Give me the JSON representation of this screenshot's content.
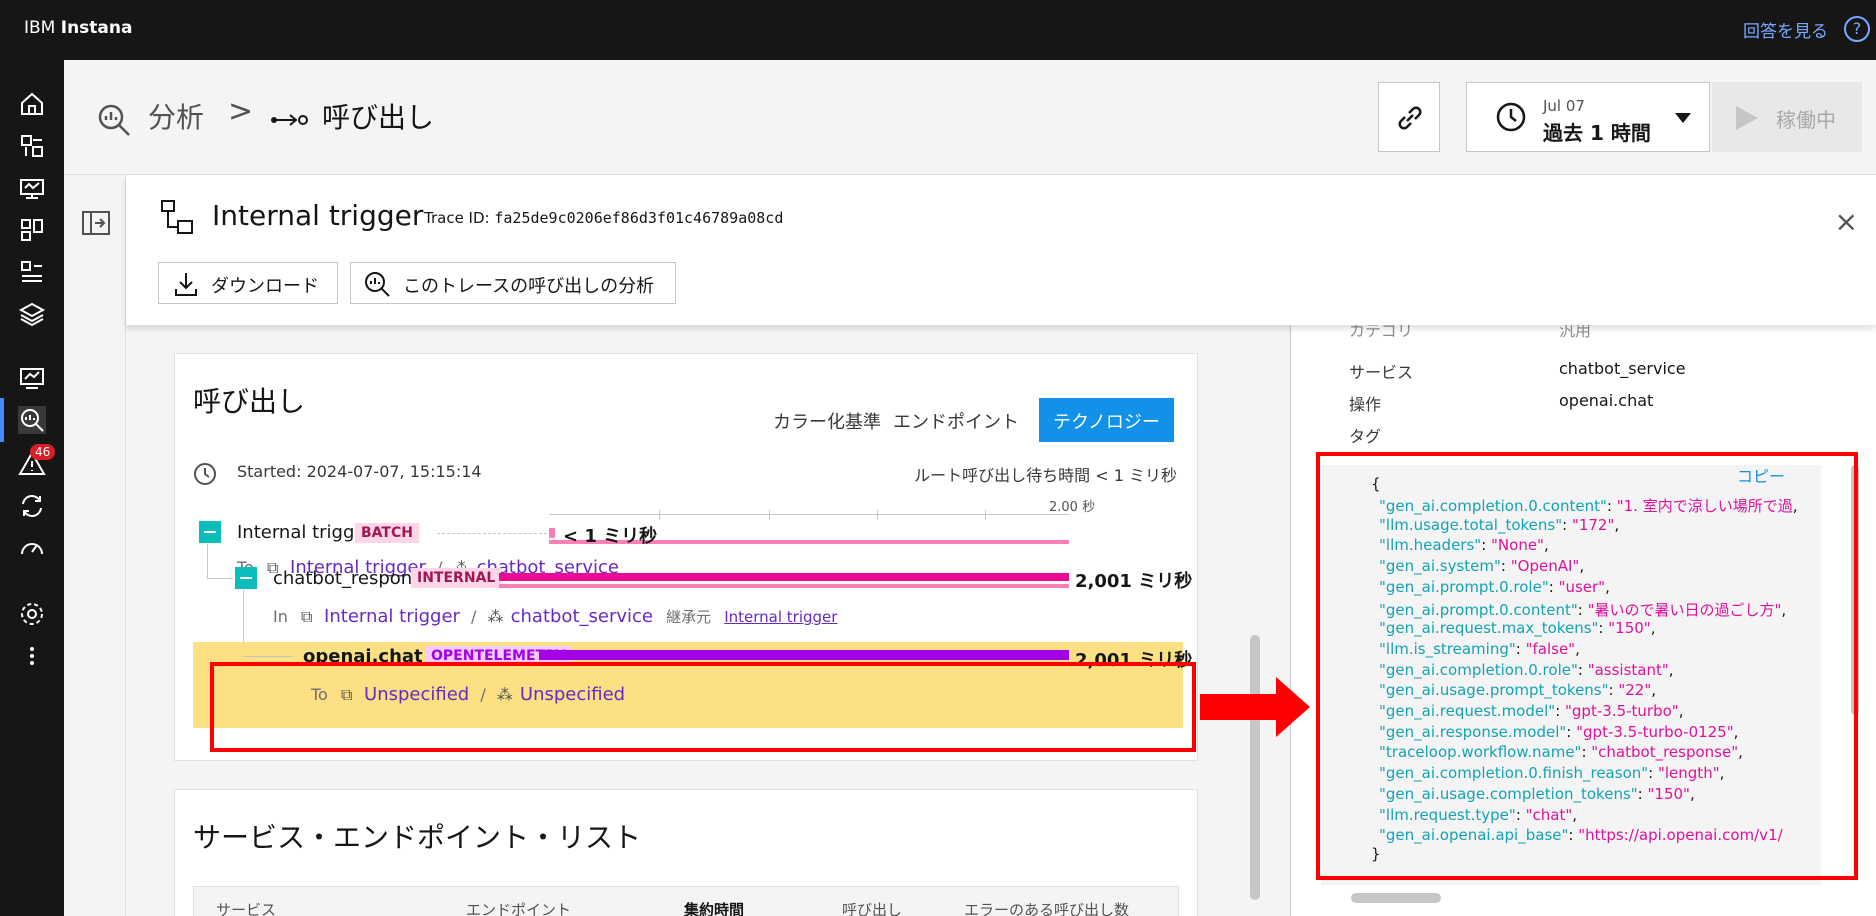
{
  "app": {
    "brand_prefix": "IBM ",
    "brand_name": "Instana",
    "help_text": "回答を見る",
    "help_icon": "?"
  },
  "nav": {
    "icons": [
      "home-icon",
      "dashboard-icon",
      "infrastructure-icon",
      "apps-icon",
      "services-icon",
      "layers-icon",
      "monitoring-icon",
      "analytics-icon",
      "alert-icon",
      "sync-icon",
      "gauge-icon",
      "settings-icon",
      "more-icon"
    ],
    "alert_badge": "46"
  },
  "header": {
    "crumb1": "分析",
    "crumb_sep": ">",
    "crumb2": "呼び出し",
    "time_date": "Jul 07",
    "time_range": "過去 1 時間",
    "run_label": "稼働中"
  },
  "trace": {
    "title": "Internal trigger",
    "trace_id_label": "Trace ID: ",
    "trace_id": "fa25de9c0206ef86d3f01c46789a08cd",
    "download_label": "ダウンロード",
    "analyze_label": "このトレースの呼び出しの分析",
    "close": "×"
  },
  "calls": {
    "title": "呼び出し",
    "color_by_label": "カラー化基準",
    "endpoint_label": "エンドポイント",
    "tech_label": "テクノロジー",
    "started": "Started: 2024-07-07, 15:15:14",
    "root_latency": "ルート呼び出し待ち時間 < 1 ミリ秒",
    "axis_tick": "2.00 秒",
    "rows": [
      {
        "name": "Internal trigger",
        "badge": "BATCH",
        "duration": "< 1 ミリ秒",
        "prefix": "To",
        "link1": "Internal trigger",
        "sep": "/",
        "link2": "chatbot_service"
      },
      {
        "name": "chatbot_response....",
        "badge": "INTERNAL",
        "duration": "2,001 ミリ秒",
        "prefix": "In",
        "link1": "Internal trigger",
        "sep": "/",
        "link2": "chatbot_service",
        "inherit_label": "継承元",
        "inherit_link": "Internal trigger"
      },
      {
        "name": "openai.chat",
        "badge": "OPENTELEMETRY",
        "duration": "2,001 ミリ秒",
        "prefix": "To",
        "link1": "Unspecified",
        "sep": "/",
        "link2": "Unspecified"
      }
    ]
  },
  "services_list": {
    "title": "サービス・エンドポイント・リスト",
    "columns": [
      "サービス",
      "エンドポイント",
      "集約時間",
      "呼び出し",
      "エラーのある呼び出し数"
    ]
  },
  "details": {
    "partial_label": "カテゴリ",
    "partial_value": "汎用",
    "service_label": "サービス",
    "service_value": "chatbot_service",
    "operation_label": "操作",
    "operation_value": "openai.chat",
    "tags_label": "タグ",
    "copy_label": "コピー",
    "json_open": "{",
    "json_close": "}",
    "json_lines": [
      {
        "k": "\"gen_ai.completion.0.content\"",
        "v": "\"1. 室内で涼しい場所で過"
      },
      {
        "k": "\"llm.usage.total_tokens\"",
        "v": "\"172\""
      },
      {
        "k": "\"llm.headers\"",
        "v": "\"None\""
      },
      {
        "k": "\"gen_ai.system\"",
        "v": "\"OpenAI\""
      },
      {
        "k": "\"gen_ai.prompt.0.role\"",
        "v": "\"user\""
      },
      {
        "k": "\"gen_ai.prompt.0.content\"",
        "v": "\"暑いので暑い日の過ごし方\""
      },
      {
        "k": "\"gen_ai.request.max_tokens\"",
        "v": "\"150\""
      },
      {
        "k": "\"llm.is_streaming\"",
        "v": "\"false\""
      },
      {
        "k": "\"gen_ai.completion.0.role\"",
        "v": "\"assistant\""
      },
      {
        "k": "\"gen_ai.usage.prompt_tokens\"",
        "v": "\"22\""
      },
      {
        "k": "\"gen_ai.request.model\"",
        "v": "\"gpt-3.5-turbo\""
      },
      {
        "k": "\"gen_ai.response.model\"",
        "v": "\"gpt-3.5-turbo-0125\""
      },
      {
        "k": "\"traceloop.workflow.name\"",
        "v": "\"chatbot_response\""
      },
      {
        "k": "\"gen_ai.completion.0.finish_reason\"",
        "v": "\"length\""
      },
      {
        "k": "\"gen_ai.usage.completion_tokens\"",
        "v": "\"150\""
      },
      {
        "k": "\"llm.request.type\"",
        "v": "\"chat\""
      },
      {
        "k": "\"gen_ai.openai.api_base\"",
        "v": "\"https://api.openai.com/v1/"
      }
    ]
  },
  "colors": {
    "accent": "#1192e8",
    "batch": "#ff7eb6",
    "internal": "#ee0a95",
    "otel": "#a400e6",
    "highlight": "#fce083",
    "annotation": "#ff0000"
  }
}
